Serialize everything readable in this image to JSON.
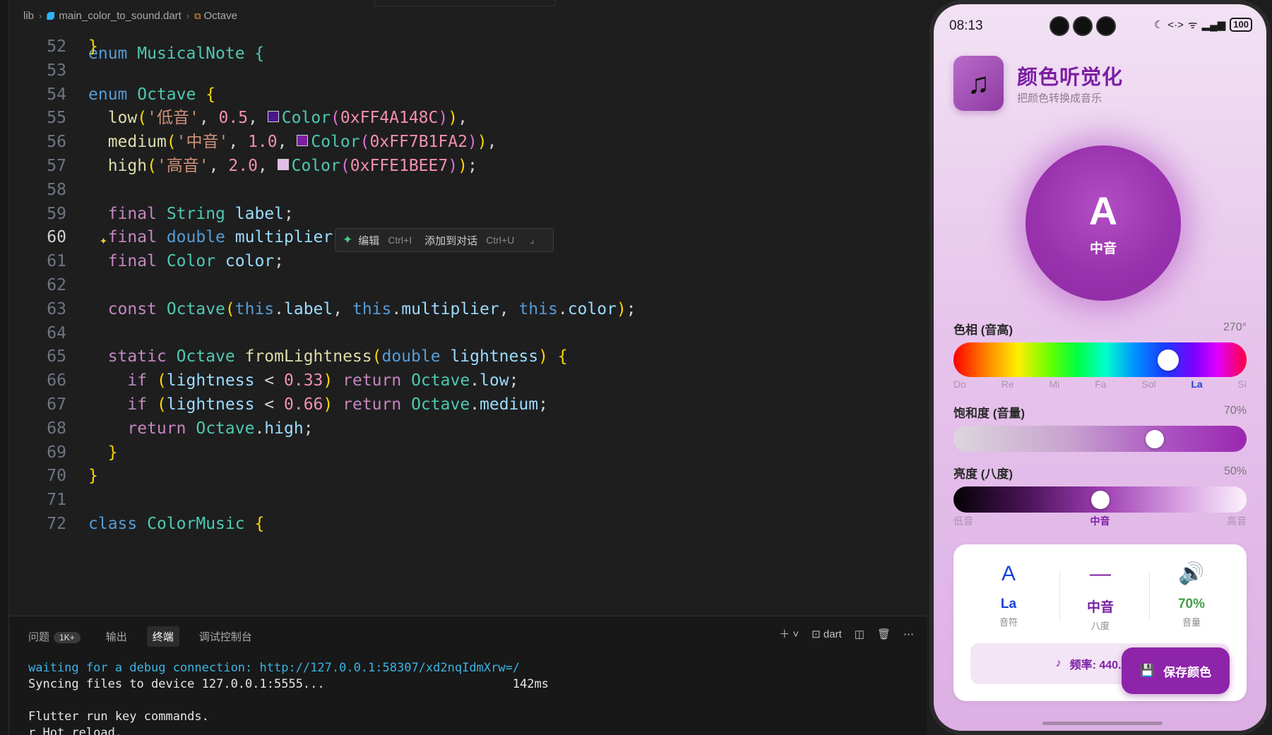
{
  "ide": {
    "breadcrumb": {
      "folder": "lib",
      "file": "main_color_to_sound.dart",
      "symbol": "Octave"
    },
    "truncated_top_line": "enum MusicalNote {",
    "active_line": "60",
    "inline_chat": {
      "edit_label": "编辑",
      "edit_hotkey": "Ctrl+I",
      "add_label": "添加到对话",
      "add_hotkey": "Ctrl+U"
    },
    "code_lines": [
      {
        "n": "52",
        "text": "}"
      },
      {
        "n": "53",
        "text": ""
      },
      {
        "n": "54",
        "text": "enum Octave {"
      },
      {
        "n": "55",
        "text": "  low('低音', 0.5, Color(0xFF4A148C)),"
      },
      {
        "n": "56",
        "text": "  medium('中音', 1.0, Color(0xFF7B1FA2)),"
      },
      {
        "n": "57",
        "text": "  high('高音', 2.0, Color(0xFFE1BEE7));"
      },
      {
        "n": "58",
        "text": ""
      },
      {
        "n": "59",
        "text": "  final String label;"
      },
      {
        "n": "60",
        "text": "  final double multiplier;"
      },
      {
        "n": "61",
        "text": "  final Color color;"
      },
      {
        "n": "62",
        "text": ""
      },
      {
        "n": "63",
        "text": "  const Octave(this.label, this.multiplier, this.color);"
      },
      {
        "n": "64",
        "text": ""
      },
      {
        "n": "65",
        "text": "  static Octave fromLightness(double lightness) {"
      },
      {
        "n": "66",
        "text": "    if (lightness < 0.33) return Octave.low;"
      },
      {
        "n": "67",
        "text": "    if (lightness < 0.66) return Octave.medium;"
      },
      {
        "n": "68",
        "text": "    return Octave.high;"
      },
      {
        "n": "69",
        "text": "  }"
      },
      {
        "n": "70",
        "text": "}"
      },
      {
        "n": "71",
        "text": ""
      },
      {
        "n": "72",
        "text": "class ColorMusic {"
      }
    ],
    "swatch_colors": [
      "#4A148C",
      "#7B1FA2",
      "#E1BEE7"
    ],
    "panel": {
      "tabs": [
        "问题",
        "输出",
        "终端",
        "调试控制台"
      ],
      "problems_badge": "1K+",
      "active_tab": "终端",
      "terminal_name": "dart",
      "terminal_lines": [
        {
          "text": "waiting for a debug connection: http://127.0.0.1:58307/xd2nqIdmXrw=/",
          "kind": "blue"
        },
        {
          "text": "Syncing files to device 127.0.0.1:5555...                          142ms",
          "kind": "white"
        },
        {
          "text": "",
          "kind": "white"
        },
        {
          "text": "Flutter run key commands.",
          "kind": "white"
        },
        {
          "text": "r Hot reload.",
          "kind": "white"
        }
      ]
    }
  },
  "phone": {
    "status": {
      "time": "08:13",
      "battery": "100"
    },
    "app": {
      "title": "颜色听觉化",
      "subtitle": "把颜色转换成音乐",
      "icon": "music-note-icon"
    },
    "preview": {
      "note": "A",
      "octave": "中音",
      "color": "#9C27B0"
    },
    "hue": {
      "label": "色相 (音高)",
      "value": "270°",
      "fraction": 0.75,
      "notes": [
        "Do",
        "Re",
        "Mi",
        "Fa",
        "Sol",
        "La",
        "Si"
      ],
      "active_note": "La"
    },
    "saturation": {
      "label": "饱和度 (音量)",
      "value": "70%",
      "fraction": 0.7
    },
    "lightness": {
      "label": "亮度 (八度)",
      "value": "50%",
      "fraction": 0.5,
      "marks": [
        "低音",
        "中音",
        "高音"
      ],
      "active_mark": "中音"
    },
    "info": [
      {
        "icon": "A",
        "value": "La",
        "caption": "音符",
        "color": "#1744D6"
      },
      {
        "icon": "—",
        "value": "中音",
        "caption": "八度",
        "color": "#7B1FA2"
      },
      {
        "icon": "🔊",
        "value": "70%",
        "caption": "音量",
        "color": "#43A047"
      }
    ],
    "frequency_text": "频率: 440.0 Hz",
    "save_button": "保存颜色"
  }
}
